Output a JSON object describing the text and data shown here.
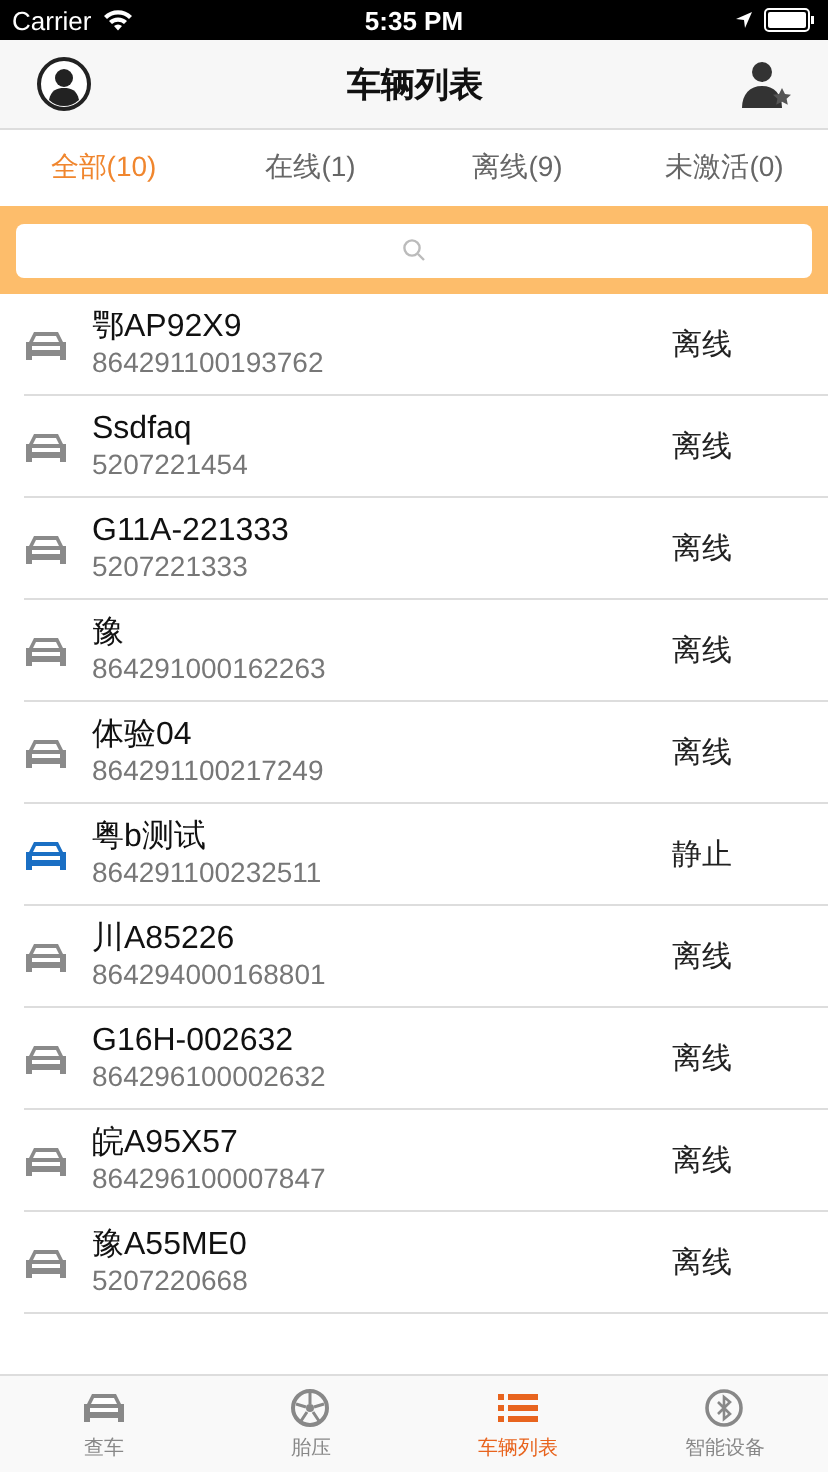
{
  "status_bar": {
    "carrier": "Carrier",
    "time": "5:35 PM"
  },
  "nav": {
    "title": "车辆列表"
  },
  "tabs": [
    {
      "label": "全部(10)",
      "selected": true
    },
    {
      "label": "在线(1)",
      "selected": false
    },
    {
      "label": "离线(9)",
      "selected": false
    },
    {
      "label": "未激活(0)",
      "selected": false
    }
  ],
  "vehicles": [
    {
      "name": "鄂AP92X9",
      "id": "864291100193762",
      "status": "离线",
      "color": "#8a8a8a"
    },
    {
      "name": "Ssdfaq",
      "id": "5207221454",
      "status": "离线",
      "color": "#8a8a8a"
    },
    {
      "name": "G11A-221333",
      "id": "5207221333",
      "status": "离线",
      "color": "#8a8a8a"
    },
    {
      "name": "豫",
      "id": "864291000162263",
      "status": "离线",
      "color": "#8a8a8a"
    },
    {
      "name": "体验04",
      "id": "864291100217249",
      "status": "离线",
      "color": "#8a8a8a"
    },
    {
      "name": "粤b测试",
      "id": "864291100232511",
      "status": "静止",
      "color": "#1a6fc4"
    },
    {
      "name": "川A85226",
      "id": "864294000168801",
      "status": "离线",
      "color": "#8a8a8a"
    },
    {
      "name": "G16H-002632",
      "id": "864296100002632",
      "status": "离线",
      "color": "#8a8a8a"
    },
    {
      "name": "皖A95X57",
      "id": "864296100007847",
      "status": "离线",
      "color": "#8a8a8a"
    },
    {
      "name": "豫A55ME0",
      "id": "5207220668",
      "status": "离线",
      "color": "#8a8a8a"
    }
  ],
  "tab_bar": [
    {
      "kind": "car",
      "label": "查车",
      "selected": false
    },
    {
      "kind": "tire",
      "label": "胎压",
      "selected": false
    },
    {
      "kind": "list",
      "label": "车辆列表",
      "selected": true
    },
    {
      "kind": "bluetooth",
      "label": "智能设备",
      "selected": false
    }
  ]
}
